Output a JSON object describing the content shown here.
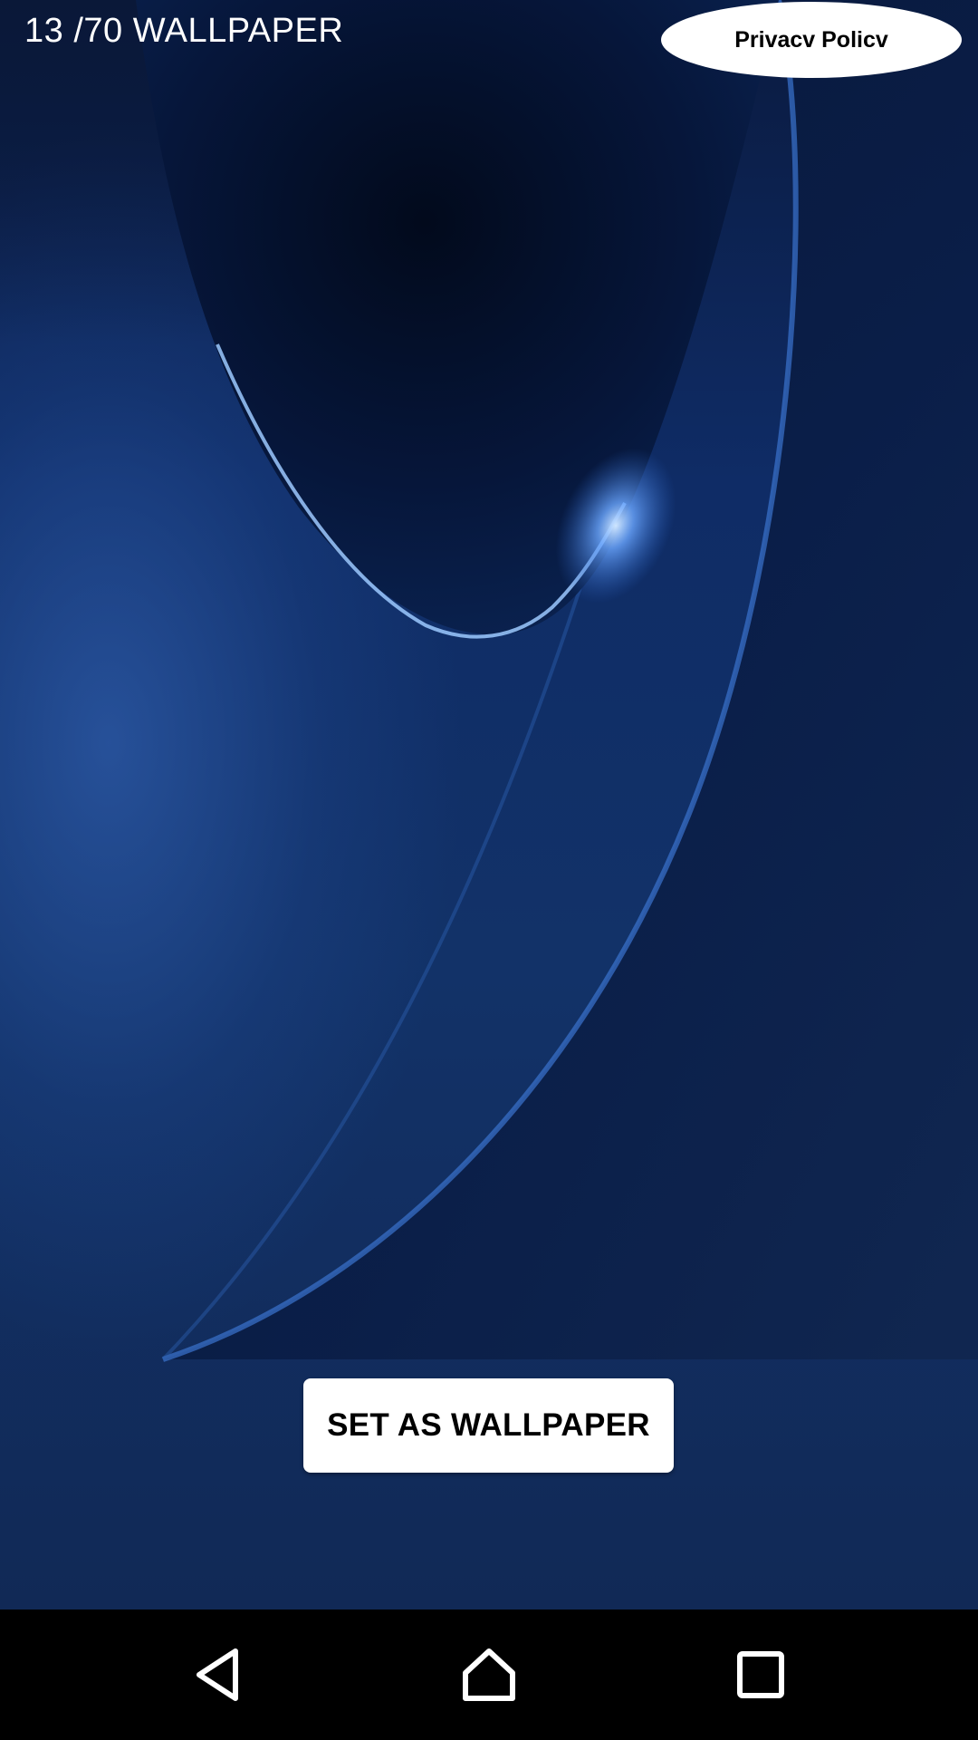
{
  "header": {
    "counter_text": "13 /70 WALLPAPER",
    "privacy_label": "Privacv Policv"
  },
  "actions": {
    "set_wallpaper_label": "SET AS WALLPAPER"
  },
  "navigation": {
    "back_icon": "back-triangle-icon",
    "home_icon": "home-icon",
    "recents_icon": "recents-square-icon"
  },
  "colors": {
    "wallpaper_dark": "#04102a",
    "wallpaper_blue": "#1e4a96",
    "highlight": "#8fc4ff",
    "button_bg": "#ffffff",
    "navbar_bg": "#000000"
  }
}
